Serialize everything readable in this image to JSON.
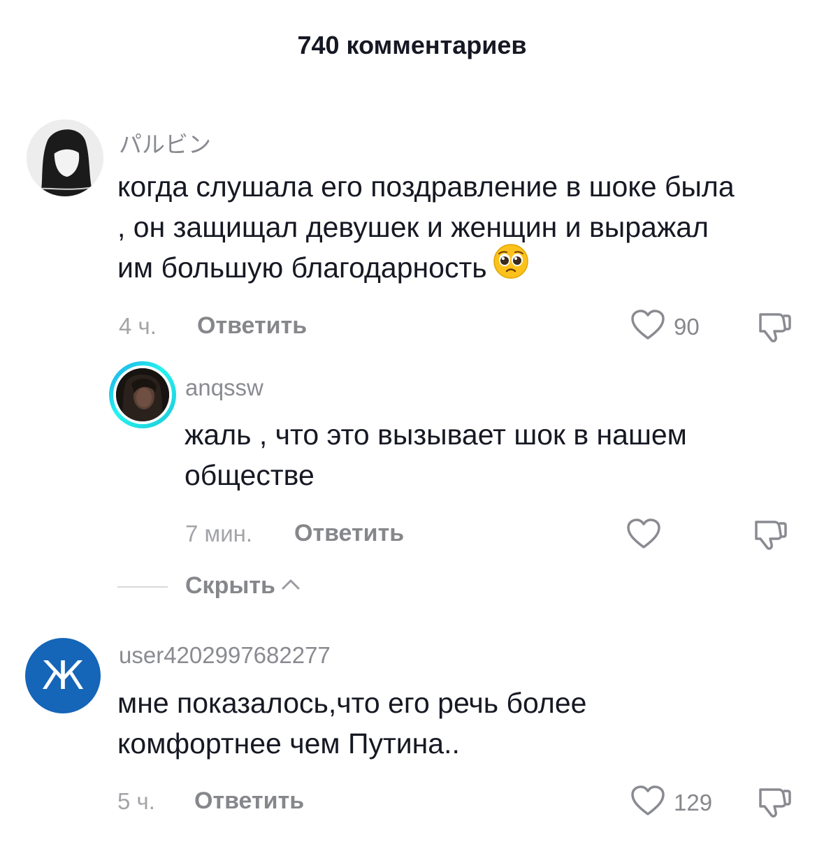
{
  "header": {
    "title": "740 комментариев"
  },
  "comments": [
    {
      "username": "パルビン",
      "text": "когда слушала его поздравление в шоке была , он защищал девушек и женщин и выражал им большую благодарность",
      "emoji": "pleading-face",
      "time": "4 ч.",
      "reply_label": "Ответить",
      "likes": "90"
    },
    {
      "username": "anqssw",
      "text": "жаль , что это вызывает шок в нашем обществе",
      "time": "7 мин.",
      "reply_label": "Ответить",
      "likes": ""
    },
    {
      "username": "user4202997682277",
      "avatar_letter": "Ж",
      "text": "мне показалось,что его речь более комфортнее чем Путина..",
      "time": "5 ч.",
      "reply_label": "Ответить",
      "likes": "129"
    }
  ],
  "replies_toggle": {
    "label": "Скрыть"
  },
  "colors": {
    "text": "#161823",
    "muted": "#86878b",
    "story_ring": "#25f4ee",
    "avatar_blue": "#1565b8"
  },
  "icons": [
    "heart-icon",
    "dislike-icon",
    "chevron-up-icon",
    "pleading-face-emoji"
  ]
}
